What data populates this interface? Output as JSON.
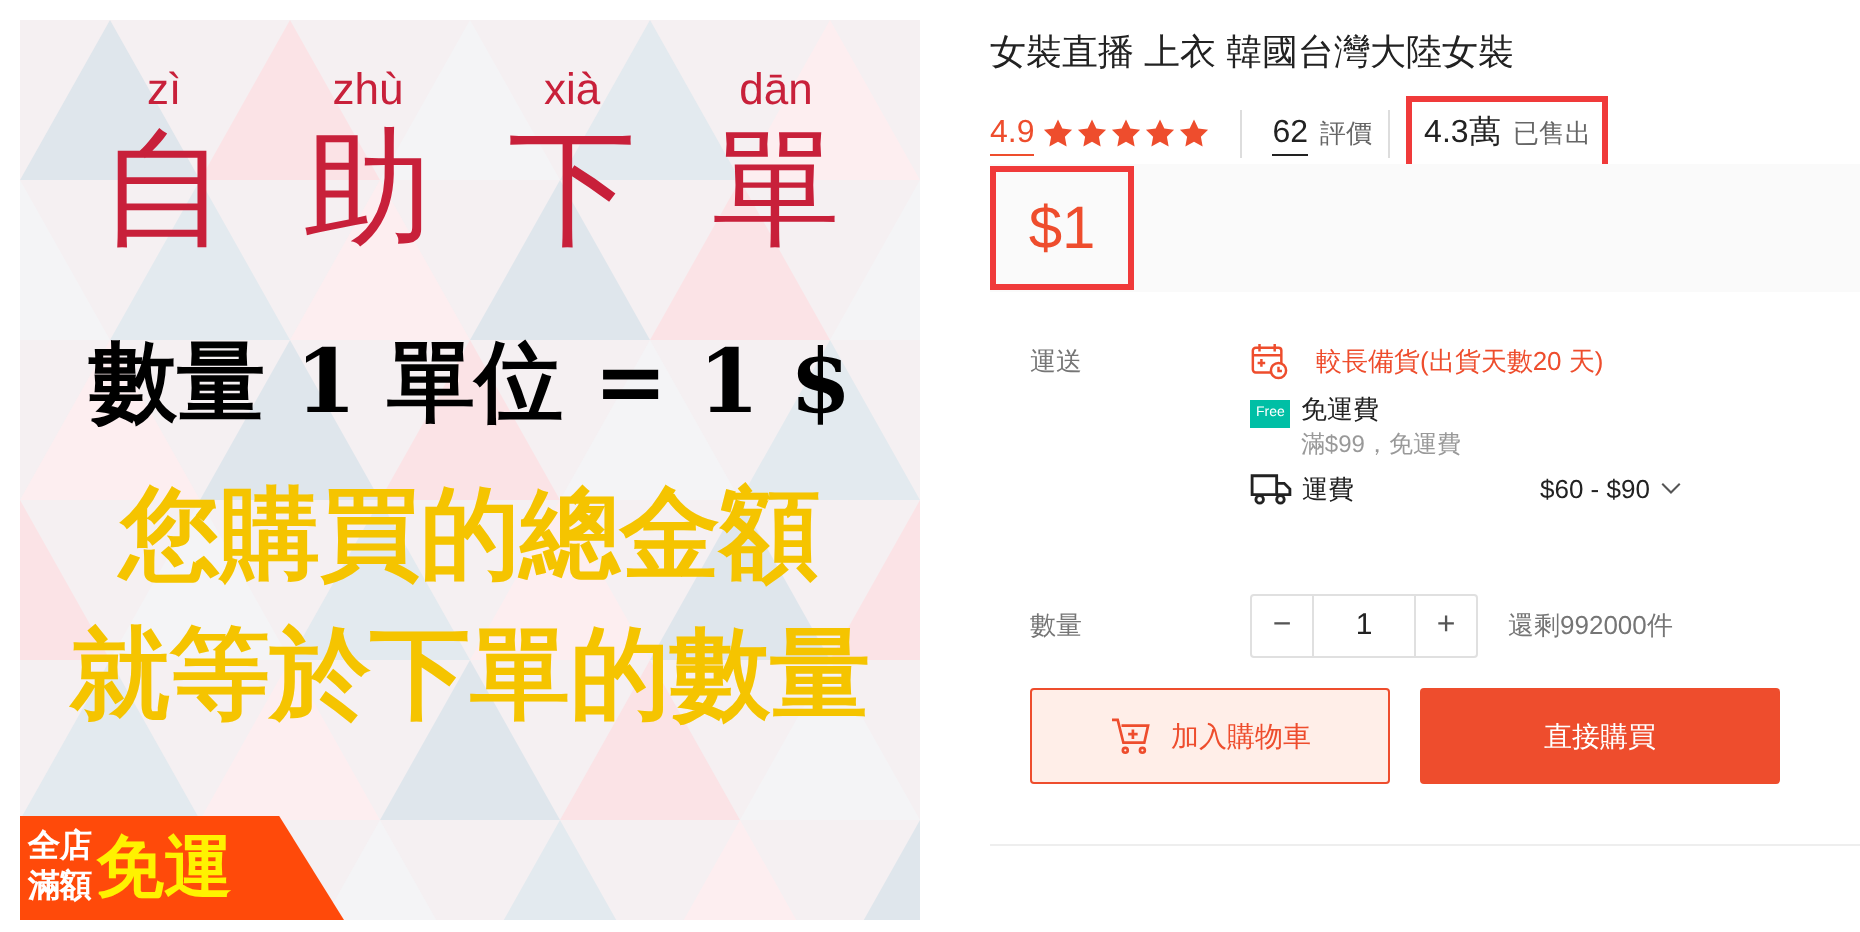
{
  "product_image": {
    "kind": "picture",
    "headline": [
      {
        "pinyin": "zì",
        "char": "自"
      },
      {
        "pinyin": "zhù",
        "char": "助"
      },
      {
        "pinyin": "xià",
        "char": "下"
      },
      {
        "pinyin": "dān",
        "char": "單"
      }
    ],
    "rule": "數量 1 單位 = 1 $",
    "lines": [
      "您購買的總金額",
      "就等於下單的數量"
    ],
    "badge": {
      "small": [
        "全店",
        "滿額"
      ],
      "big": "免運"
    }
  },
  "title": "女裝直播 上衣 韓國台灣大陸女裝",
  "rating": {
    "score": "4.9",
    "stars": 5,
    "reviews_count": "62",
    "reviews_label": "評價",
    "sold_count": "4.3萬",
    "sold_label": "已售出",
    "highlighted": true
  },
  "price": {
    "value": "$1",
    "highlighted": true
  },
  "shipping": {
    "label": "運送",
    "preparation": "較長備貨(出貨天數20 天)",
    "free_title": "免運費",
    "free_note": "滿$99，免運費",
    "free_badge": "Free",
    "fee_label": "運費",
    "fee_range": "$60 - $90"
  },
  "quantity": {
    "label": "數量",
    "minus": "−",
    "value": "1",
    "plus": "+",
    "stock": "還剩992000件"
  },
  "buttons": {
    "add_to_cart": "加入購物車",
    "buy_now": "直接購買"
  }
}
